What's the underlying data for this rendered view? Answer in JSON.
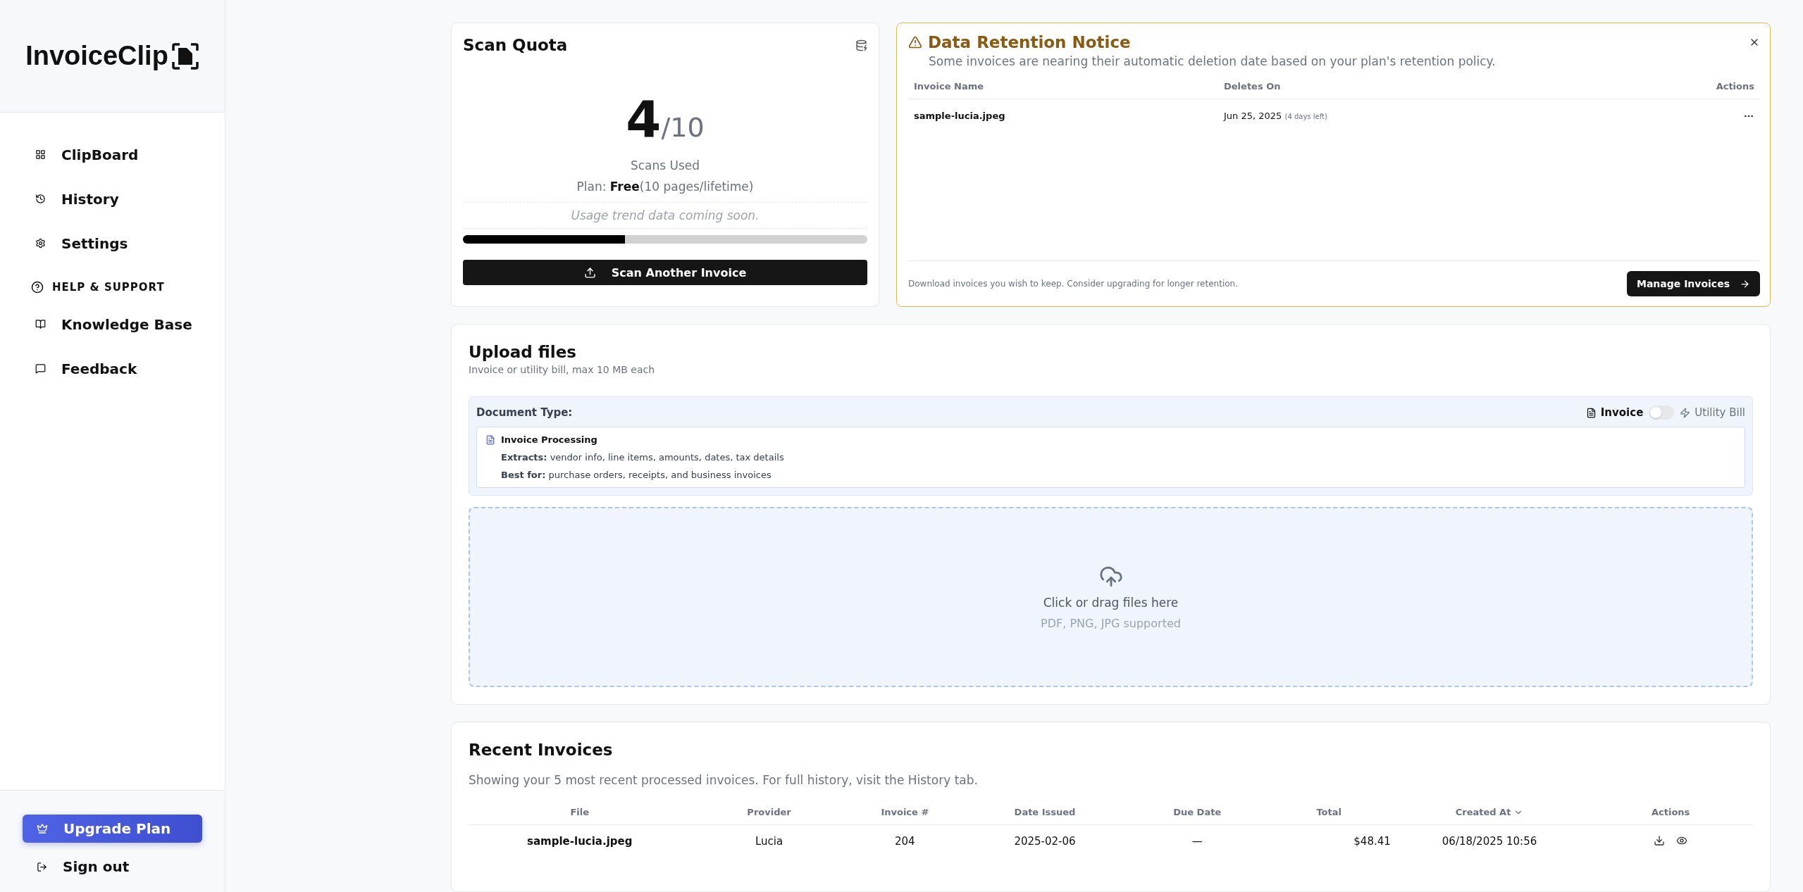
{
  "sidebar": {
    "logo": "InvoiceClip",
    "nav": [
      {
        "label": "ClipBoard"
      },
      {
        "label": "History"
      },
      {
        "label": "Settings"
      }
    ],
    "section": {
      "title": "HELP & SUPPORT",
      "items": [
        {
          "label": "Knowledge Base"
        },
        {
          "label": "Feedback"
        }
      ]
    },
    "upgrade": "Upgrade Plan",
    "sign_out": "Sign out"
  },
  "quota": {
    "title": "Scan Quota",
    "used": "4",
    "total": "/10",
    "caption": "Scans Used",
    "plan_label": "Plan: ",
    "plan": "Free",
    "plan_detail": "(10 pages/lifetime)",
    "trend": "Usage trend data coming soon.",
    "level": 0.4,
    "button": "Scan Another Invoice"
  },
  "notice": {
    "title": "Data Retention Notice",
    "message": "Some invoices are nearing their automatic deletion date based on your plan's retention policy.",
    "columns": [
      "Invoice Name",
      "Deletes On",
      "Actions"
    ],
    "rows": [
      {
        "name": "sample-lucia.jpeg",
        "date": "Jun 25, 2025",
        "left": "(4 days left)"
      }
    ],
    "footer": "Download invoices you wish to keep. Consider upgrading for longer retention.",
    "button": "Manage Invoices"
  },
  "upload": {
    "title": "Upload files",
    "subtitle": "Invoice or utility bill, max 10 MB each",
    "doc_type_label": "Document Type:",
    "options": [
      {
        "label": "Invoice",
        "selected": true
      },
      {
        "label": "Utility Bill",
        "selected": false
      }
    ],
    "toggle": {
      "on": false
    },
    "info": {
      "title": "Invoice Processing",
      "lines": [
        {
          "label": "Extracts:",
          "text": "vendor info, line items, amounts, dates, tax details"
        },
        {
          "label": "Best for:",
          "text": "purchase orders, receipts, and business invoices"
        }
      ]
    },
    "drop_text": "Click or drag files here",
    "drop_hint": "PDF, PNG, JPG supported"
  },
  "recent": {
    "title": "Recent Invoices",
    "subtitle": "Showing your 5 most recent processed invoices. For full history, visit the History tab.",
    "columns": [
      {
        "label": "File",
        "sorted": false
      },
      {
        "label": "Provider",
        "sorted": false
      },
      {
        "label": "Invoice #",
        "sorted": false
      },
      {
        "label": "Date Issued",
        "sorted": false
      },
      {
        "label": "Due Date",
        "sorted": false
      },
      {
        "label": "Total",
        "sorted": false
      },
      {
        "label": "Created At",
        "sorted": true
      },
      {
        "label": "Actions",
        "sorted": false
      }
    ],
    "rows": [
      {
        "file": "sample-lucia.jpeg",
        "provider": "Lucia",
        "number": "204",
        "issued": "2025-02-06",
        "due": "—",
        "total": "$48.41",
        "created": "06/18/2025 10:56"
      }
    ]
  }
}
